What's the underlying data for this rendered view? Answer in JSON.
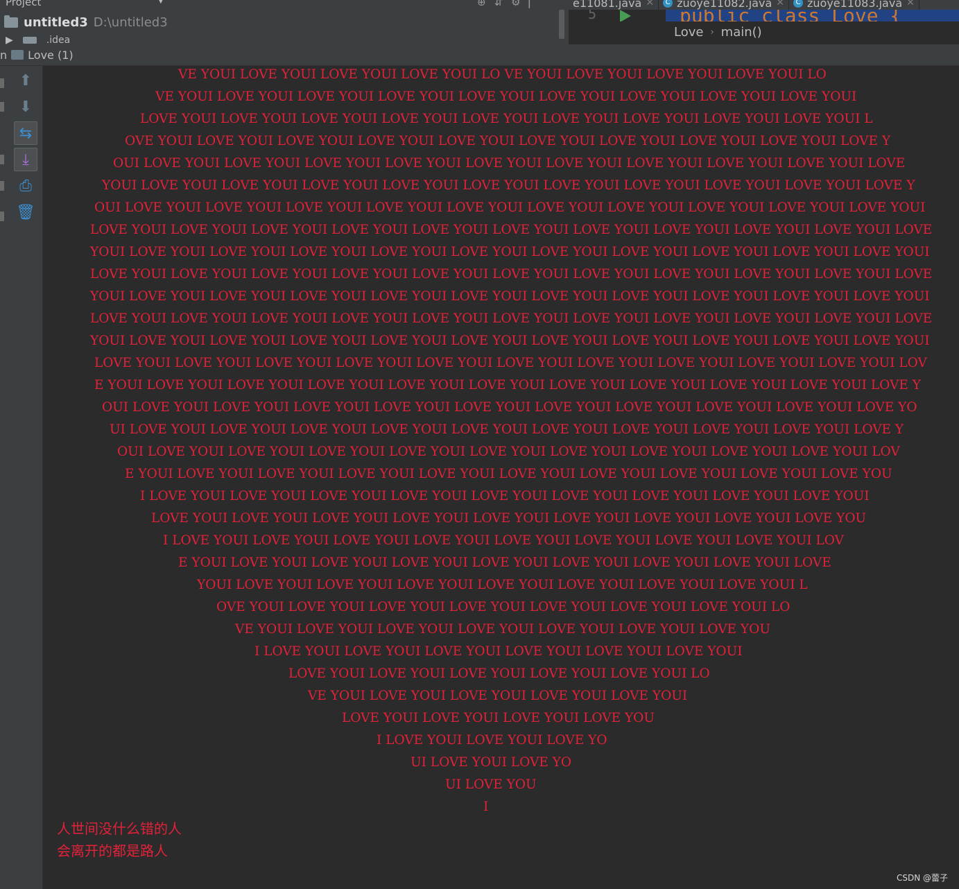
{
  "project_panel": {
    "title": "Project",
    "root_name": "untitled3",
    "root_path": "D:\\untitled3",
    "child_folder": ".idea"
  },
  "editor": {
    "tabs": [
      {
        "label": "e11081.java"
      },
      {
        "label": "zuoye11082.java"
      },
      {
        "label": "zuoye11083.java"
      }
    ],
    "line_number": "5",
    "code": "public class Love {",
    "breadcrumb": [
      "Love",
      "main()"
    ]
  },
  "run": {
    "prefix": "n",
    "tab_label": "Love (1)"
  },
  "console_lines": [
    "VE YOUI LOVE YOUI LOVE YOUI LOVE YOUI LO VE YOUI LOVE YOUI LOVE YOUI LOVE YOUI LO",
    "VE YOUI LOVE YOUI LOVE YOUI LOVE YOUI LOVE YOUI LOVE YOUI LOVE YOUI LOVE YOUI LOVE YOUI",
    "LOVE YOUI LOVE YOUI LOVE YOUI LOVE YOUI LOVE YOUI LOVE YOUI LOVE YOUI LOVE YOUI LOVE YOUI L",
    "OVE YOUI LOVE YOUI LOVE YOUI LOVE YOUI LOVE YOUI LOVE YOUI LOVE YOUI LOVE YOUI LOVE YOUI LOVE Y",
    "OUI LOVE YOUI LOVE YOUI LOVE YOUI LOVE YOUI LOVE YOUI LOVE YOUI LOVE YOUI LOVE YOUI LOVE YOUI LOVE",
    "YOUI LOVE YOUI LOVE YOUI LOVE YOUI LOVE YOUI LOVE YOUI LOVE YOUI LOVE YOUI LOVE YOUI LOVE YOUI LOVE Y",
    "OUI LOVE YOUI LOVE YOUI LOVE YOUI LOVE YOUI LOVE YOUI LOVE YOUI LOVE YOUI LOVE YOUI LOVE YOUI LOVE YOUI",
    "LOVE YOUI LOVE YOUI LOVE YOUI LOVE YOUI LOVE YOUI LOVE YOUI LOVE YOUI LOVE YOUI LOVE YOUI LOVE YOUI LOVE",
    "YOUI LOVE YOUI LOVE YOUI LOVE YOUI LOVE YOUI LOVE YOUI LOVE YOUI LOVE YOUI LOVE YOUI LOVE YOUI LOVE YOUI",
    "LOVE YOUI LOVE YOUI LOVE YOUI LOVE YOUI LOVE YOUI LOVE YOUI LOVE YOUI LOVE YOUI LOVE YOUI LOVE YOUI LOVE",
    "YOUI LOVE YOUI LOVE YOUI LOVE YOUI LOVE YOUI LOVE YOUI LOVE YOUI LOVE YOUI LOVE YOUI LOVE YOUI LOVE YOUI",
    "LOVE YOUI LOVE YOUI LOVE YOUI LOVE YOUI LOVE YOUI LOVE YOUI LOVE YOUI LOVE YOUI LOVE YOUI LOVE YOUI LOVE",
    "YOUI LOVE YOUI LOVE YOUI LOVE YOUI LOVE YOUI LOVE YOUI LOVE YOUI LOVE YOUI LOVE YOUI LOVE YOUI LOVE YOUI",
    "LOVE YOUI LOVE YOUI LOVE YOUI LOVE YOUI LOVE YOUI LOVE YOUI LOVE YOUI LOVE YOUI LOVE YOUI LOVE YOUI LOV",
    "E YOUI LOVE YOUI LOVE YOUI LOVE YOUI LOVE YOUI LOVE YOUI LOVE YOUI LOVE YOUI LOVE YOUI LOVE YOUI LOVE Y",
    "OUI LOVE YOUI LOVE YOUI LOVE YOUI LOVE YOUI LOVE YOUI LOVE YOUI LOVE YOUI LOVE YOUI LOVE YOUI LOVE YO",
    "UI LOVE YOUI LOVE YOUI LOVE YOUI LOVE YOUI LOVE YOUI LOVE YOUI LOVE YOUI LOVE YOUI LOVE YOUI LOVE Y",
    "OUI LOVE YOUI LOVE YOUI LOVE YOUI LOVE YOUI LOVE YOUI LOVE YOUI LOVE YOUI LOVE YOUI LOVE YOUI LOV",
    "E YOUI LOVE YOUI LOVE YOUI LOVE YOUI LOVE YOUI LOVE YOUI LOVE YOUI LOVE YOUI LOVE YOUI LOVE YOU",
    "I LOVE YOUI LOVE YOUI LOVE YOUI LOVE YOUI LOVE YOUI LOVE YOUI LOVE YOUI LOVE YOUI LOVE YOUI",
    "LOVE YOUI LOVE YOUI LOVE YOUI LOVE YOUI LOVE YOUI LOVE YOUI LOVE YOUI LOVE YOUI LOVE YOU",
    "I LOVE YOUI LOVE YOUI LOVE YOUI LOVE YOUI LOVE YOUI LOVE YOUI LOVE YOUI LOVE YOUI LOV",
    "E YOUI LOVE YOUI LOVE YOUI LOVE YOUI LOVE YOUI LOVE YOUI LOVE YOUI LOVE YOUI LOVE",
    "YOUI LOVE YOUI LOVE YOUI LOVE YOUI LOVE YOUI LOVE YOUI LOVE YOUI LOVE YOUI L",
    "OVE YOUI LOVE YOUI LOVE YOUI LOVE YOUI LOVE YOUI LOVE YOUI LOVE YOUI LO",
    "VE YOUI LOVE YOUI LOVE YOUI LOVE YOUI LOVE YOUI LOVE YOUI LOVE YOU",
    "I LOVE YOUI LOVE YOUI LOVE YOUI LOVE YOUI LOVE YOUI LOVE YOUI",
    "LOVE YOUI LOVE YOUI LOVE YOUI LOVE YOUI LOVE YOUI LO",
    "VE YOUI LOVE YOUI LOVE YOUI LOVE YOUI LOVE YOUI",
    "LOVE YOUI LOVE YOUI LOVE YOUI LOVE YOU",
    "I LOVE YOUI LOVE YOUI LOVE YO",
    "UI LOVE YOUI LOVE YO",
    "UI LOVE YOU",
    "I"
  ],
  "console_footer": [
    "人世间没什么错的人",
    "会离开的都是路人"
  ],
  "watermark": "CSDN @蕾子",
  "colors": {
    "console_text": "#e0223a",
    "background": "#2b2b2b",
    "panel": "#3c3f41"
  }
}
